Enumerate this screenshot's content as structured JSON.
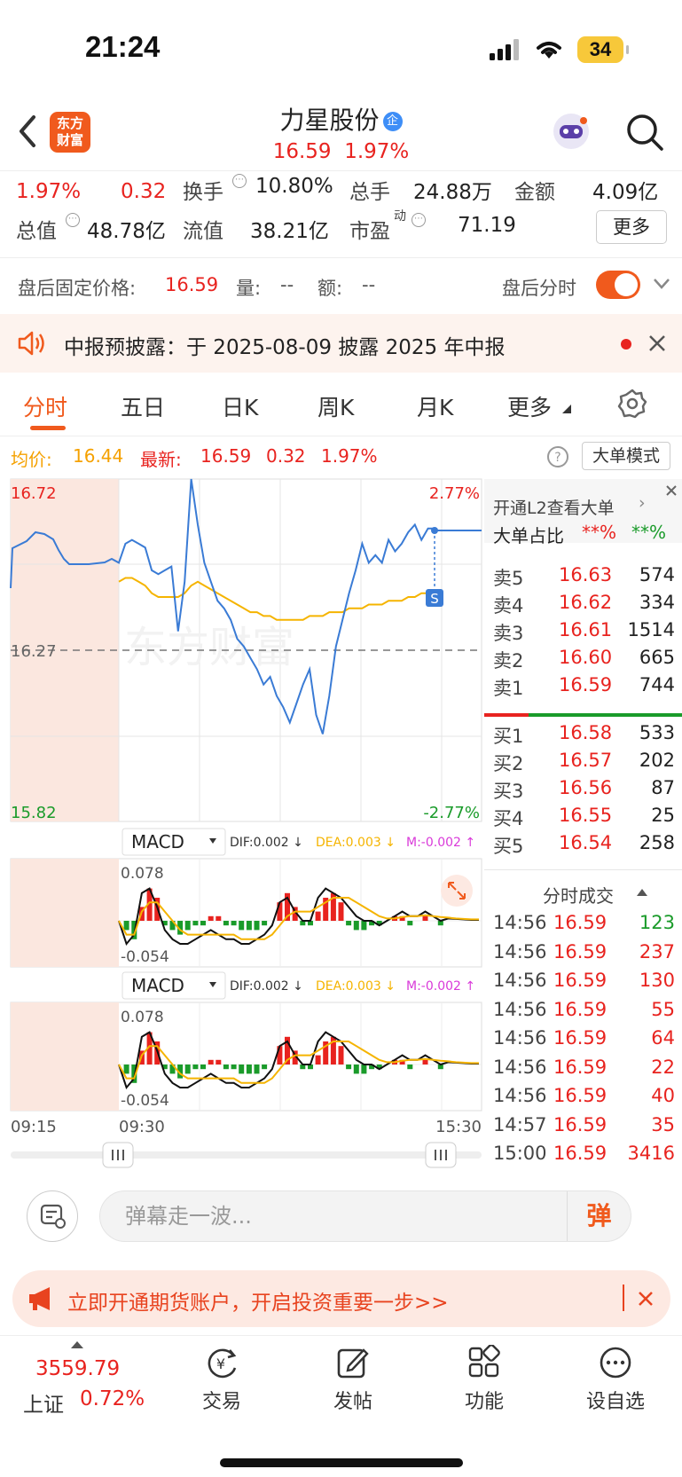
{
  "status_bar": {
    "time": "21:24",
    "battery": "34"
  },
  "header": {
    "logo_line1": "东方",
    "logo_line2": "财富",
    "stock_name": "力星股份",
    "badge": "企",
    "price": "16.59",
    "change_pct": "1.97%"
  },
  "stats": {
    "pct": "1.97%",
    "change": "0.32",
    "turnover_label": "换手",
    "turnover": "10.80%",
    "volume_label": "总手",
    "volume": "24.88万",
    "amount_label": "金额",
    "amount": "4.09亿",
    "mktcap_label": "总值",
    "mktcap": "48.78亿",
    "float_label": "流值",
    "float": "38.21亿",
    "pe_label": "市盈",
    "pe_sup": "动",
    "pe": "71.19",
    "more": "更多"
  },
  "after_hours": {
    "label": "盘后固定价格:",
    "price": "16.59",
    "vol_label": "量:",
    "vol": "--",
    "amt_label": "额:",
    "amt": "--",
    "switch_label": "盘后分时"
  },
  "notice": {
    "text": "中报预披露：于 2025-08-09 披露 2025 年中报"
  },
  "tabs": [
    "分时",
    "五日",
    "日K",
    "周K",
    "月K",
    "更多"
  ],
  "chart_info": {
    "avg_label": "均价:",
    "avg": "16.44",
    "last_label": "最新:",
    "last": "16.59",
    "change": "0.32",
    "pct": "1.97%",
    "big_order_mode": "大单模式"
  },
  "chart_data": {
    "type": "line",
    "y_top": "16.72",
    "y_mid": "16.27",
    "y_bottom": "15.82",
    "pct_top": "2.77%",
    "pct_bottom": "-2.77%",
    "x_labels": [
      "09:15",
      "09:30",
      "15:30"
    ],
    "watermark": "东方财富",
    "s_marker": "S",
    "ylim": [
      15.82,
      16.72
    ],
    "series": [
      {
        "name": "price",
        "values": [
          16.5,
          16.55,
          16.56,
          16.55,
          16.54,
          16.48,
          16.47,
          16.48,
          16.49,
          16.32,
          16.45,
          16.72,
          16.6,
          16.5,
          16.45,
          16.4,
          16.38,
          16.35,
          16.3,
          16.28,
          16.25,
          16.22,
          16.18,
          16.2,
          16.15,
          16.12,
          16.08,
          16.13,
          16.18,
          16.22,
          16.1,
          16.05,
          16.15,
          16.28,
          16.35,
          16.42,
          16.48,
          16.55,
          16.5,
          16.52,
          16.5,
          16.56,
          16.53,
          16.55,
          16.58,
          16.6,
          16.56,
          16.59,
          16.59
        ]
      },
      {
        "name": "avg",
        "values": [
          16.45,
          16.46,
          16.46,
          16.45,
          16.44,
          16.42,
          16.41,
          16.41,
          16.41,
          16.41,
          16.42,
          16.44,
          16.45,
          16.44,
          16.43,
          16.42,
          16.41,
          16.4,
          16.39,
          16.38,
          16.37,
          16.37,
          16.36,
          16.36,
          16.35,
          16.35,
          16.35,
          16.35,
          16.35,
          16.36,
          16.36,
          16.36,
          16.37,
          16.37,
          16.37,
          16.38,
          16.38,
          16.38,
          16.39,
          16.39,
          16.39,
          16.4,
          16.4,
          16.4,
          16.41,
          16.41,
          16.42,
          16.42,
          16.42
        ]
      }
    ]
  },
  "macd": [
    {
      "label": "MACD",
      "dif": "DIF:0.002 ↓",
      "dea": "DEA:0.003 ↓",
      "m": "M:-0.002 ↑",
      "top": "0.078",
      "bottom": "-0.054",
      "hist": [
        0.0,
        -0.02,
        -0.04,
        0.03,
        0.07,
        0.05,
        -0.01,
        -0.02,
        -0.03,
        -0.02,
        -0.01,
        -0.01,
        0.01,
        0.01,
        -0.01,
        -0.01,
        -0.02,
        -0.02,
        -0.02,
        -0.01,
        0.0,
        0.04,
        0.06,
        0.03,
        -0.01,
        -0.01,
        0.02,
        0.05,
        0.06,
        0.04,
        -0.01,
        -0.02,
        -0.02,
        -0.01,
        -0.01,
        0.0,
        0.01,
        0.01,
        -0.01,
        0.0,
        0.01,
        0.0,
        -0.01,
        0.0,
        0.0,
        0.0,
        0.0,
        0.0
      ],
      "dif_line": [
        0.0,
        -0.05,
        -0.03,
        0.06,
        0.07,
        0.03,
        -0.02,
        -0.04,
        -0.05,
        -0.05,
        -0.04,
        -0.03,
        -0.02,
        -0.03,
        -0.04,
        -0.04,
        -0.05,
        -0.05,
        -0.04,
        -0.03,
        -0.01,
        0.04,
        0.05,
        0.02,
        0.0,
        0.0,
        0.05,
        0.07,
        0.06,
        0.05,
        0.03,
        0.01,
        0.0,
        0.0,
        -0.01,
        0.0,
        0.01,
        0.02,
        0.01,
        0.01,
        0.02,
        0.01,
        0.0,
        0.005,
        0.004,
        0.003,
        0.002,
        0.002
      ],
      "dea_line": [
        0.0,
        -0.03,
        -0.03,
        0.02,
        0.04,
        0.04,
        0.02,
        0.0,
        -0.02,
        -0.03,
        -0.03,
        -0.03,
        -0.03,
        -0.03,
        -0.03,
        -0.03,
        -0.04,
        -0.04,
        -0.04,
        -0.04,
        -0.03,
        -0.01,
        0.01,
        0.02,
        0.02,
        0.02,
        0.03,
        0.04,
        0.05,
        0.05,
        0.05,
        0.04,
        0.03,
        0.02,
        0.01,
        0.005,
        0.005,
        0.008,
        0.01,
        0.01,
        0.012,
        0.01,
        0.008,
        0.007,
        0.005,
        0.004,
        0.003,
        0.003
      ]
    },
    {
      "label": "MACD",
      "dif": "DIF:0.002 ↓",
      "dea": "DEA:0.003 ↓",
      "m": "M:-0.002 ↑",
      "top": "0.078",
      "bottom": "-0.054"
    }
  ],
  "order_book": {
    "l2_link": "开通L2查看大单",
    "ratio_label": "大单占比",
    "ratio_buy": "**%",
    "ratio_sell": "**%",
    "asks": [
      {
        "label": "卖5",
        "price": "16.63",
        "vol": "574"
      },
      {
        "label": "卖4",
        "price": "16.62",
        "vol": "334"
      },
      {
        "label": "卖3",
        "price": "16.61",
        "vol": "1514"
      },
      {
        "label": "卖2",
        "price": "16.60",
        "vol": "665"
      },
      {
        "label": "卖1",
        "price": "16.59",
        "vol": "744"
      }
    ],
    "bids": [
      {
        "label": "买1",
        "price": "16.58",
        "vol": "533"
      },
      {
        "label": "买2",
        "price": "16.57",
        "vol": "202"
      },
      {
        "label": "买3",
        "price": "16.56",
        "vol": "87"
      },
      {
        "label": "买4",
        "price": "16.55",
        "vol": "25"
      },
      {
        "label": "买5",
        "price": "16.54",
        "vol": "258"
      }
    ],
    "ticks_title": "分时成交",
    "ticks": [
      {
        "time": "14:56",
        "price": "16.59",
        "vol": "123",
        "dir": "up"
      },
      {
        "time": "14:56",
        "price": "16.59",
        "vol": "237",
        "dir": "down"
      },
      {
        "time": "14:56",
        "price": "16.59",
        "vol": "130",
        "dir": "down"
      },
      {
        "time": "14:56",
        "price": "16.59",
        "vol": "55",
        "dir": "down"
      },
      {
        "time": "14:56",
        "price": "16.59",
        "vol": "64",
        "dir": "down"
      },
      {
        "time": "14:56",
        "price": "16.59",
        "vol": "22",
        "dir": "down"
      },
      {
        "time": "14:56",
        "price": "16.59",
        "vol": "40",
        "dir": "down"
      },
      {
        "time": "14:57",
        "price": "16.59",
        "vol": "35",
        "dir": "down"
      },
      {
        "time": "15:00",
        "price": "16.59",
        "vol": "3416",
        "dir": "down"
      }
    ]
  },
  "danmu": {
    "placeholder": "弹幕走一波...",
    "button": "弹"
  },
  "ad": {
    "text": "立即开通期货账户，开启投资重要一步>>"
  },
  "bottom_nav": {
    "index_value": "3559.79",
    "index_name": "上证",
    "index_pct": "0.72%",
    "items": [
      "交易",
      "发帖",
      "功能",
      "设自选"
    ]
  },
  "colors": {
    "accent": "#f05a1d",
    "up": "#e8231f",
    "down": "#1a9b2a",
    "price_line": "#3a7bd5",
    "avg_line": "#f5b400"
  }
}
